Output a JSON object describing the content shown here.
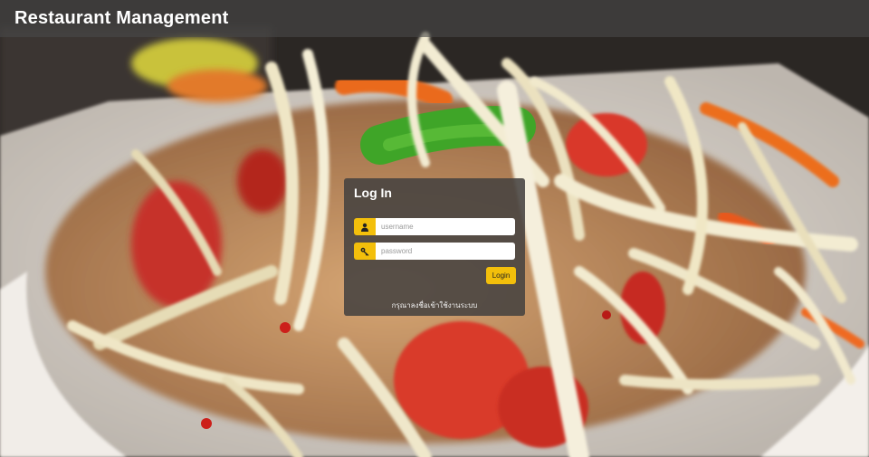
{
  "app": {
    "title": "Restaurant Management"
  },
  "login": {
    "heading": "Log In",
    "username_placeholder": "username",
    "password_placeholder": "password",
    "username_icon": "user-icon",
    "password_icon": "key-icon",
    "submit_label": "Login",
    "hint_text": "กรุณาลงชื่อเข้าใช้งานระบบ"
  },
  "colors": {
    "accent": "#f3bf0b",
    "navbar": "#484848",
    "card": "#46423f"
  }
}
